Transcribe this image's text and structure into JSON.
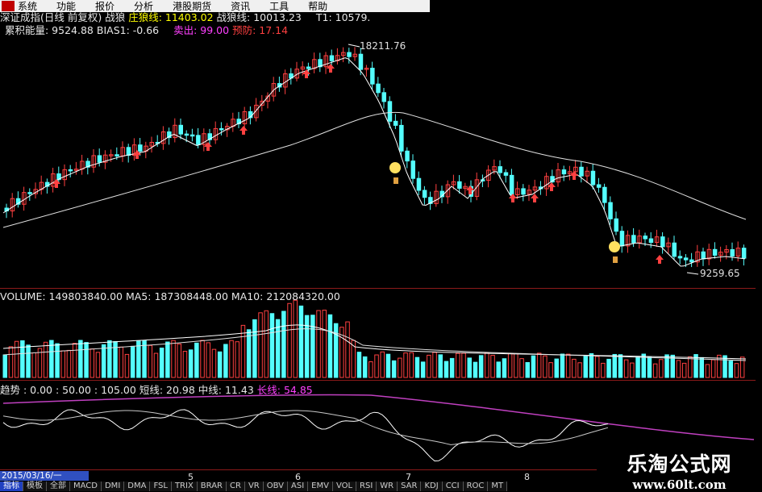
{
  "menu": {
    "logo": "",
    "items": [
      "系统",
      "功能",
      "报价",
      "分析",
      "港股期货",
      "资讯",
      "工具",
      "帮助"
    ]
  },
  "header": {
    "title": "深证成指(日线 前复权)",
    "zhanlang_label": "战狼",
    "zhuanglang": "庄狼线: 11403.02",
    "zhanlangxian": "战狼线: 10013.23",
    "t1": "T1: 10579.",
    "energy": "累积能量: 9524.88",
    "bias": "BIAS1: -0.66",
    "sell": "卖出: 99.00",
    "warn": "预防: 17.14"
  },
  "price_labels": {
    "high": "18211.76",
    "low": "9259.65"
  },
  "volume_header": {
    "volume": "VOLUME: 149803840.00",
    "ma5": "MA5: 187308448.00",
    "ma10": "MA10: 212084320.00"
  },
  "indicator_header": {
    "trend": "趋势 : 0.00 : 50.00 : 105.00",
    "short": "短线: 20.98",
    "mid": "中线: 11.43",
    "long": "长线: 54.85"
  },
  "x_ticks": [
    "5",
    "6",
    "7",
    "8"
  ],
  "bottom": {
    "date": "2015/03/16/一",
    "tabs": [
      "指标",
      "模板",
      "全部",
      "MACD",
      "DMI",
      "DMA",
      "FSL",
      "TRIX",
      "BRAR",
      "CR",
      "VR",
      "OBV",
      "ASI",
      "EMV",
      "VOL",
      "RSI",
      "WR",
      "SAR",
      "KDJ",
      "CCI",
      "ROC",
      "MT"
    ]
  },
  "watermark": {
    "line1": "乐淘公式网",
    "line2": "www.60lt.com"
  },
  "colors": {
    "up": "#ff4040",
    "down": "#54ffff",
    "ma": "#ffffff",
    "long_line": "#c040c0",
    "separator": "#8b1a1a"
  }
}
